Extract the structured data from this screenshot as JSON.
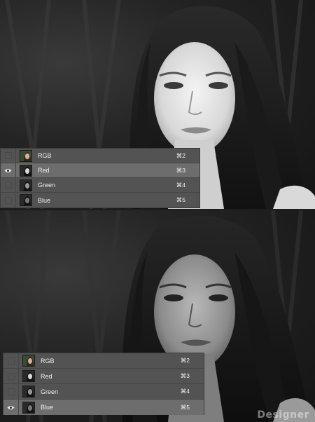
{
  "top_panel": {
    "rows": [
      {
        "label": "RGB",
        "shortcut": "⌘2",
        "visible": false,
        "selected": false,
        "thumb": "rgb"
      },
      {
        "label": "Red",
        "shortcut": "⌘3",
        "visible": true,
        "selected": true,
        "thumb": "gray"
      },
      {
        "label": "Green",
        "shortcut": "⌘4",
        "visible": false,
        "selected": false,
        "thumb": "gray"
      },
      {
        "label": "Blue",
        "shortcut": "⌘5",
        "visible": false,
        "selected": false,
        "thumb": "gray"
      }
    ]
  },
  "bottom_panel": {
    "rows": [
      {
        "label": "RGB",
        "shortcut": "⌘2",
        "visible": false,
        "selected": false,
        "thumb": "rgb"
      },
      {
        "label": "Red",
        "shortcut": "⌘3",
        "visible": false,
        "selected": false,
        "thumb": "gray"
      },
      {
        "label": "Green",
        "shortcut": "⌘4",
        "visible": false,
        "selected": false,
        "thumb": "gray"
      },
      {
        "label": "Blue",
        "shortcut": "⌘5",
        "visible": true,
        "selected": true,
        "thumb": "gray"
      }
    ]
  },
  "watermark": "Designer",
  "icons": {
    "visibility": "eye-icon"
  },
  "colors": {
    "panel": "#535353",
    "selected_row": "#6d6d6d",
    "text": "#f0f0f0"
  }
}
